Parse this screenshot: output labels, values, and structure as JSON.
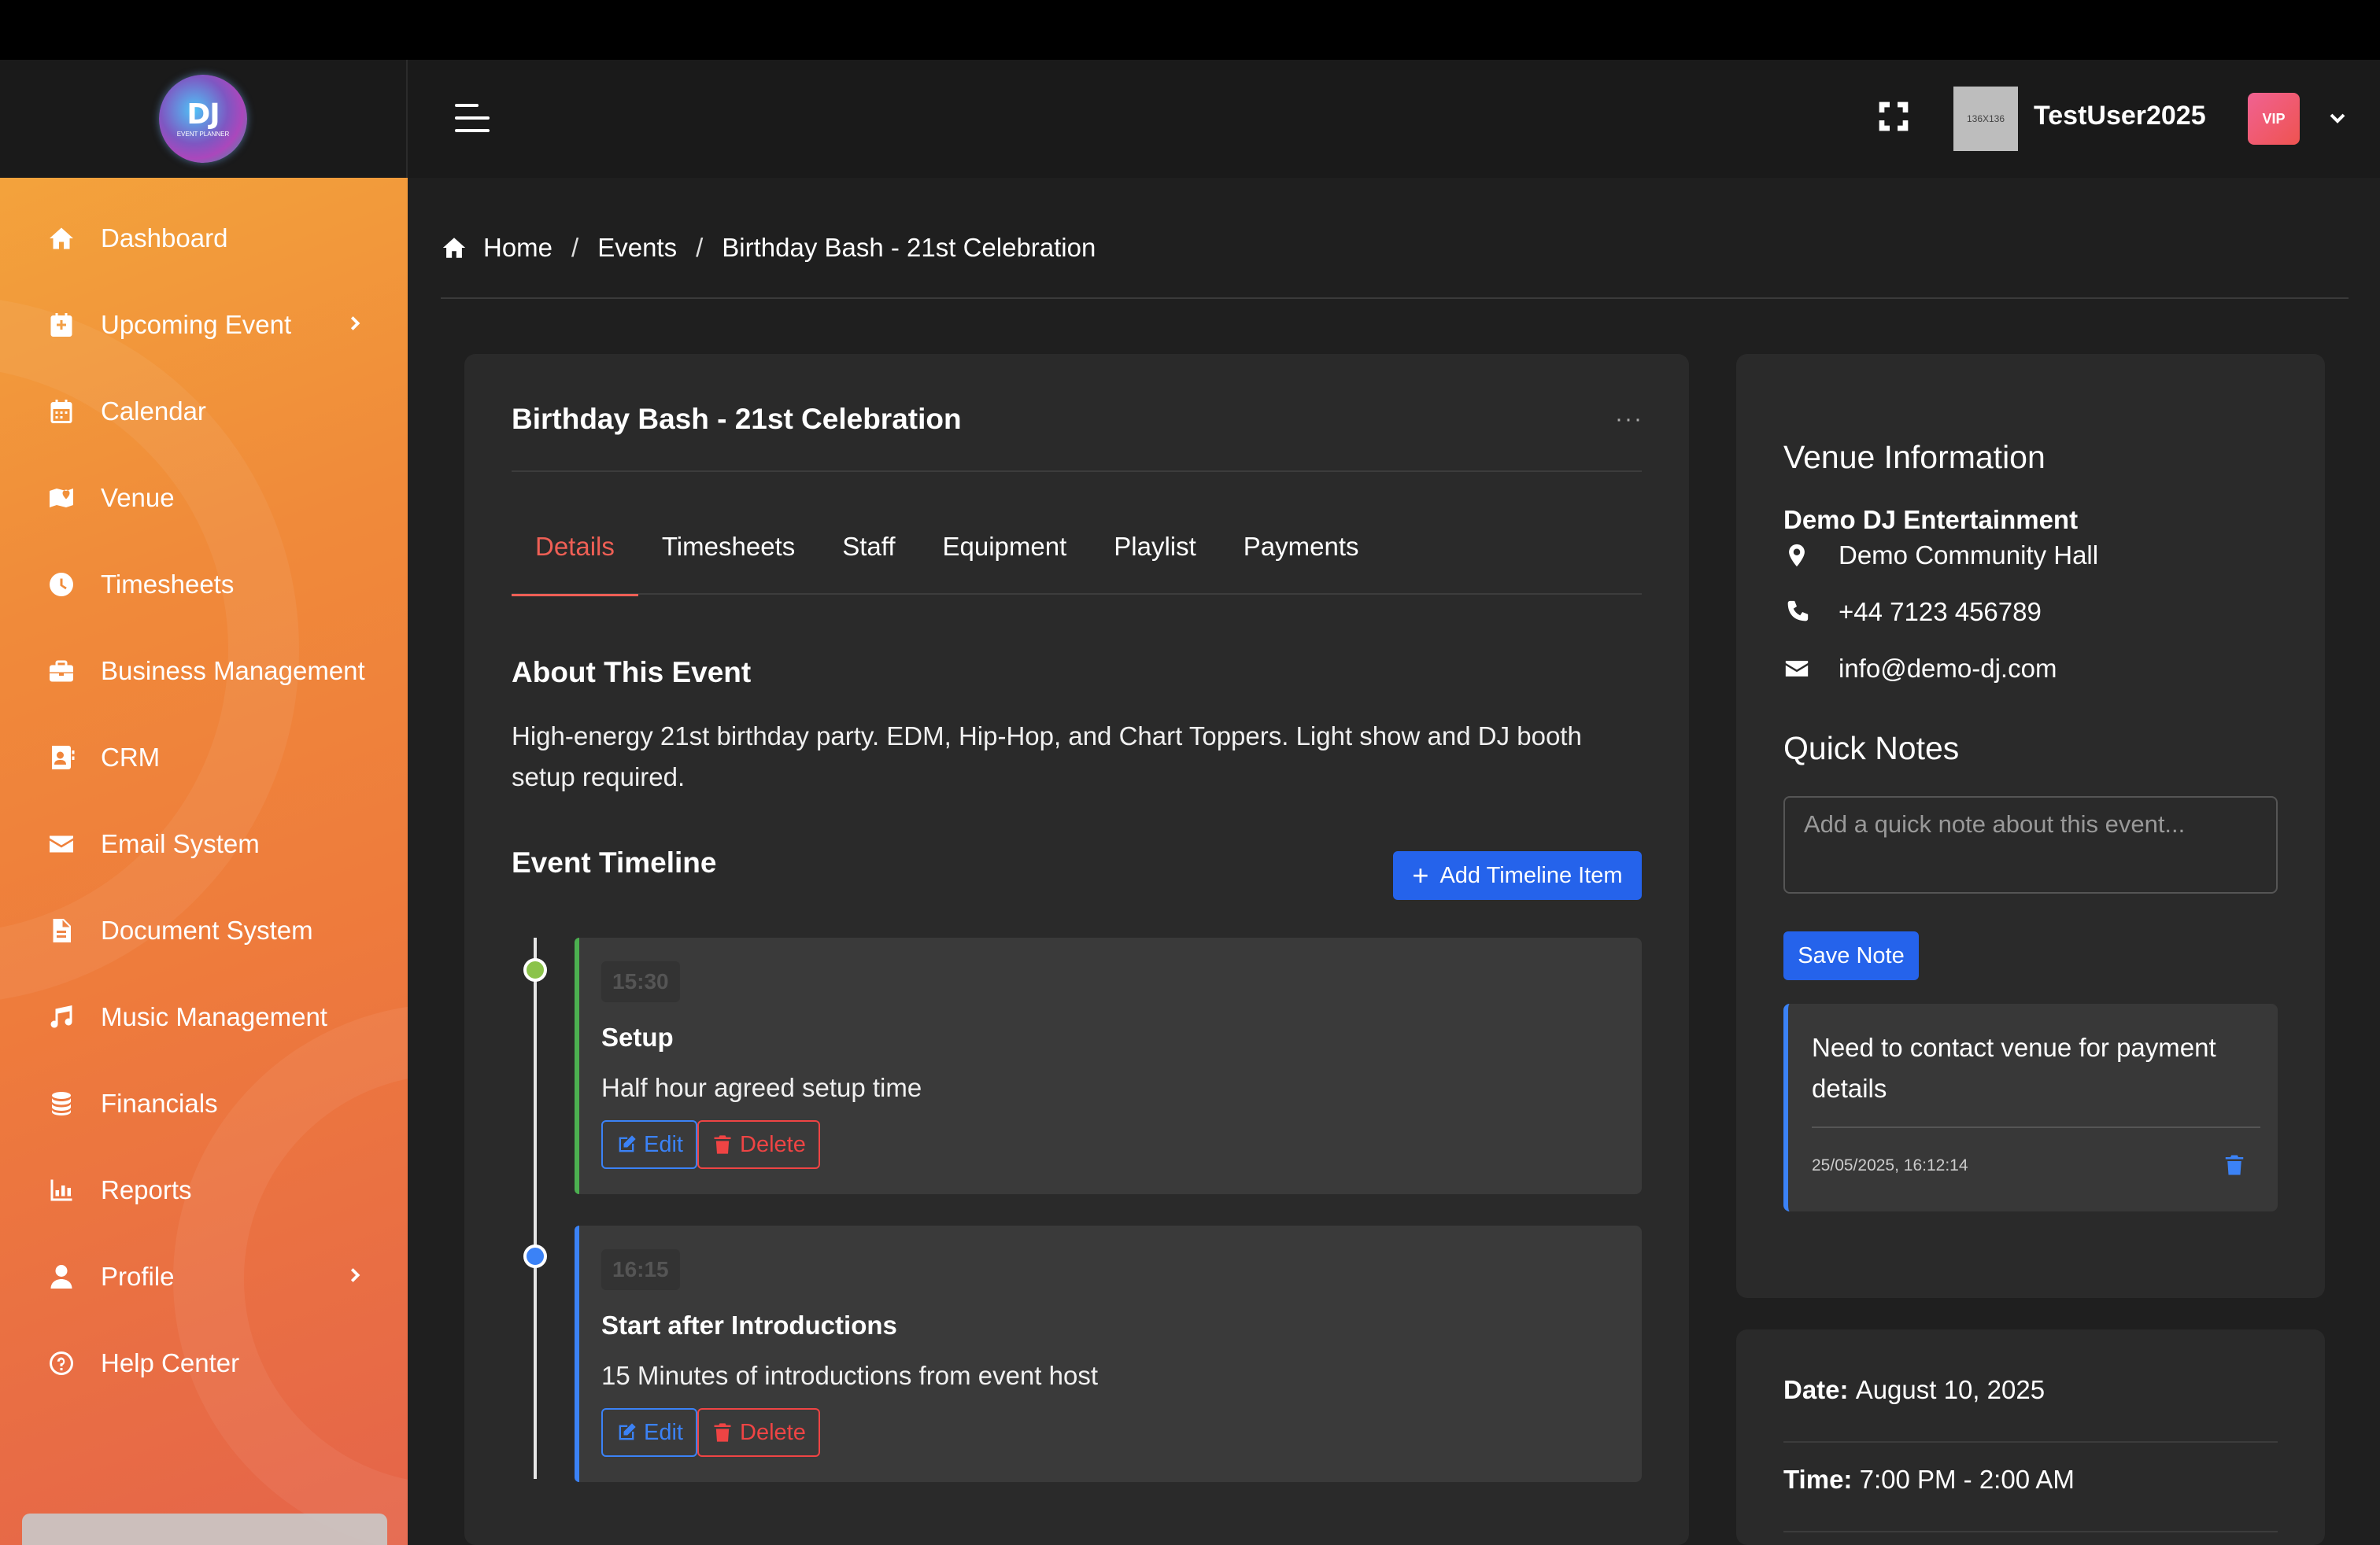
{
  "app": {
    "logo_text": "DJ",
    "logo_subtext": "EVENT PLANNER"
  },
  "sidebar": {
    "items": [
      {
        "label": "Dashboard",
        "icon": "home-icon",
        "chevron": false
      },
      {
        "label": "Upcoming Event",
        "icon": "calendar-plus-icon",
        "chevron": true
      },
      {
        "label": "Calendar",
        "icon": "calendar-icon",
        "chevron": false
      },
      {
        "label": "Venue",
        "icon": "map-icon",
        "chevron": false
      },
      {
        "label": "Timesheets",
        "icon": "clock-icon",
        "chevron": false
      },
      {
        "label": "Business Management",
        "icon": "briefcase-icon",
        "chevron": false
      },
      {
        "label": "CRM",
        "icon": "contact-card-icon",
        "chevron": false
      },
      {
        "label": "Email System",
        "icon": "envelope-icon",
        "chevron": false
      },
      {
        "label": "Document System",
        "icon": "document-icon",
        "chevron": false
      },
      {
        "label": "Music Management",
        "icon": "music-note-icon",
        "chevron": false
      },
      {
        "label": "Financials",
        "icon": "coins-icon",
        "chevron": false
      },
      {
        "label": "Reports",
        "icon": "chart-icon",
        "chevron": false
      },
      {
        "label": "Profile",
        "icon": "user-icon",
        "chevron": true
      },
      {
        "label": "Help Center",
        "icon": "question-icon",
        "chevron": false
      }
    ]
  },
  "header": {
    "avatar_placeholder": "136X136",
    "username": "TestUser2025",
    "badge": "VIP"
  },
  "breadcrumb": {
    "home": "Home",
    "events": "Events",
    "current": "Birthday Bash - 21st Celebration",
    "separator": "/"
  },
  "event": {
    "title": "Birthday Bash - 21st Celebration",
    "menu": "···",
    "tabs": [
      "Details",
      "Timesheets",
      "Staff",
      "Equipment",
      "Playlist",
      "Payments"
    ],
    "active_tab": "Details",
    "about_heading": "About This Event",
    "about_text": "High-energy 21st birthday party. EDM, Hip-Hop, and Chart Toppers. Light show and DJ booth setup required.",
    "timeline_heading": "Event Timeline",
    "add_button": "Add Timeline Item",
    "timeline": [
      {
        "time": "15:30",
        "title": "Setup",
        "description": "Half hour agreed setup time",
        "color": "#4caf50",
        "dot_color": "#8bc34a"
      },
      {
        "time": "16:15",
        "title": "Start after Introductions",
        "description": "15 Minutes of introductions from event host",
        "color": "#3b82f6",
        "dot_color": "#3b82f6"
      }
    ],
    "edit_label": "Edit",
    "delete_label": "Delete"
  },
  "venue": {
    "heading": "Venue Information",
    "name": "Demo DJ Entertainment",
    "address": "Demo Community Hall",
    "phone": "+44 7123 456789",
    "email": "info@demo-dj.com"
  },
  "notes": {
    "heading": "Quick Notes",
    "placeholder": "Add a quick note about this event...",
    "save_button": "Save Note",
    "items": [
      {
        "text": "Need to contact venue for payment details",
        "timestamp": "25/05/2025, 16:12:14"
      }
    ]
  },
  "details": {
    "date_label": "Date:",
    "date_value": "August 10, 2025",
    "time_label": "Time:",
    "time_value": "7:00 PM - 2:00 AM"
  },
  "colors": {
    "accent_red": "#ef5f55",
    "primary_blue": "#2563eb",
    "sidebar_gradient_start": "#f4a93c",
    "sidebar_gradient_end": "#e5644a"
  }
}
